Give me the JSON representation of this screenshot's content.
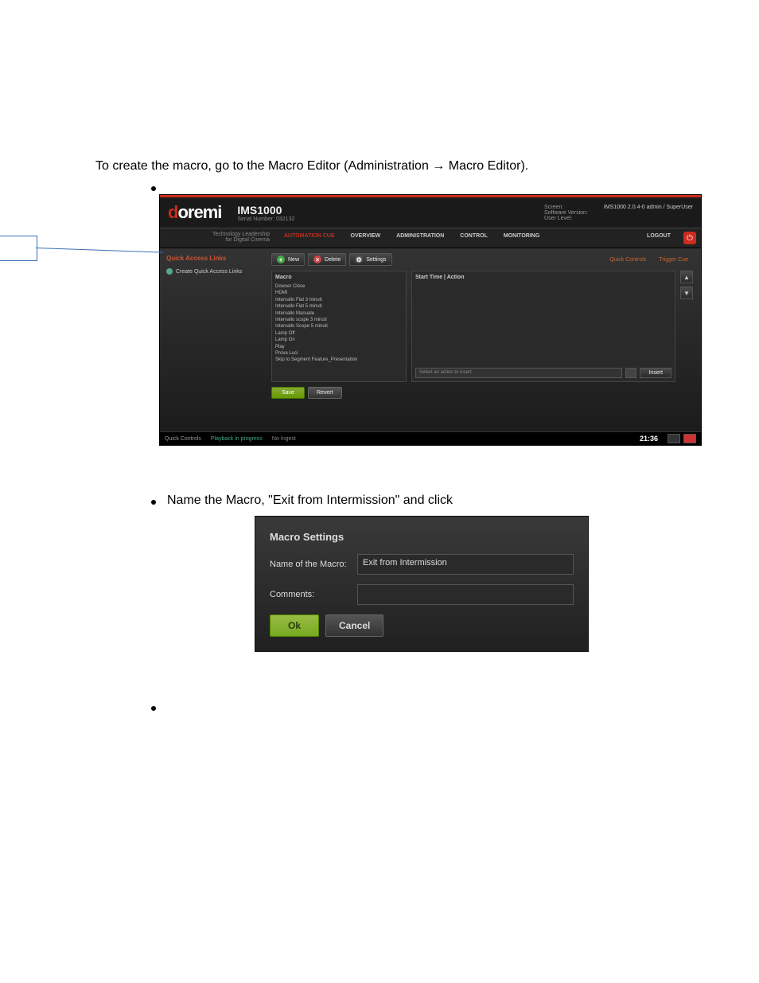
{
  "doc": {
    "intro": "To create the macro, go to the Macro Editor (Administration → Macro Editor).",
    "step2": "Name the Macro, \"Exit from Intermission\" and click"
  },
  "header": {
    "logo_d": "d",
    "logo_rest": "oremi",
    "product": "IMS1000",
    "serial_lbl": "Serial Number: 032132",
    "info": {
      "screen_lbl": "Screen:",
      "screen_val": "IMS1000",
      "sw_lbl": "Software Version:",
      "sw_val": "2.0.4-0",
      "user_lbl": "User Level:",
      "user_val": "admin / SuperUser"
    }
  },
  "nav": {
    "tagline1": "Technology Leadership",
    "tagline2": "for Digital Cinema",
    "tabs": [
      "Automation Cue",
      "OVERVIEW",
      "ADMINISTRATION",
      "CONTROL",
      "MONITORING"
    ],
    "logout": "LOGOUT"
  },
  "sidebar": {
    "title": "Quick Access Links",
    "link": "Create Quick Access Links"
  },
  "toolbar": {
    "new": "New",
    "delete": "Delete",
    "settings": "Settings",
    "quick_controls": "Quick Controls",
    "trigger_cue": "Trigger Cue"
  },
  "macro_panel": {
    "label": "Macro",
    "items": [
      "Dowser Close",
      "HDMI",
      "Intervallo Flat 3 minuti",
      "Intervallo Flat 5 minuti",
      "Intervallo Manuale",
      "Intervallo scope 3 minuti",
      "Intervallo Scope 5 minuti",
      "Lamp Off",
      "Lamp On",
      "Play",
      "Prova Luci",
      "Skip to Segment Feature_Presentation"
    ]
  },
  "action_panel": {
    "header": "Start Time | Action",
    "select_placeholder": "Select an action to insert",
    "insert": "Insert"
  },
  "buttons": {
    "save": "Save",
    "revert": "Revert"
  },
  "footer": {
    "quick": "Quick Controls",
    "playback": "Playback in progress",
    "ingest": "No Ingest",
    "time": "21:36"
  },
  "dialog": {
    "title": "Macro Settings",
    "name_lbl": "Name of the Macro:",
    "name_val": "Exit from Intermission",
    "comments_lbl": "Comments:",
    "comments_val": "",
    "ok": "Ok",
    "cancel": "Cancel"
  }
}
